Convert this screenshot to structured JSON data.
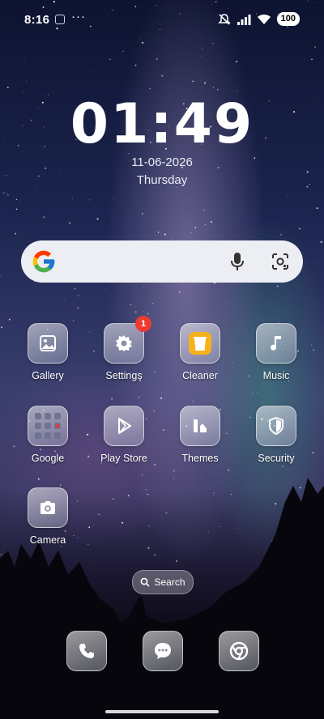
{
  "status_bar": {
    "time": "8:16",
    "more": "···",
    "battery": "100",
    "icons": [
      "notification-icon",
      "mute-icon",
      "signal-icon",
      "wifi-icon",
      "battery-icon"
    ]
  },
  "clock": {
    "time": "01:49",
    "date": "11-06-2026",
    "day": "Thursday"
  },
  "search_bar": {
    "icons": [
      "google-logo",
      "mic-icon",
      "lens-icon"
    ]
  },
  "apps": [
    {
      "label": "Gallery",
      "icon": "gallery-icon"
    },
    {
      "label": "Settings",
      "icon": "gear-icon",
      "badge": "1"
    },
    {
      "label": "Cleaner",
      "icon": "trash-icon"
    },
    {
      "label": "Music",
      "icon": "music-note-icon"
    },
    {
      "label": "Google",
      "icon": "folder-icon"
    },
    {
      "label": "Play Store",
      "icon": "play-store-icon"
    },
    {
      "label": "Themes",
      "icon": "themes-icon"
    },
    {
      "label": "Security",
      "icon": "shield-icon"
    },
    {
      "label": "Camera",
      "icon": "camera-icon"
    }
  ],
  "search_pill": {
    "label": "Search"
  },
  "dock": [
    {
      "icon": "phone-icon"
    },
    {
      "icon": "messages-icon"
    },
    {
      "icon": "chrome-icon"
    }
  ],
  "colors": {
    "badge": "#ee3b32",
    "cleaner": "#f6b21a",
    "searchbar": "#eceef3"
  }
}
